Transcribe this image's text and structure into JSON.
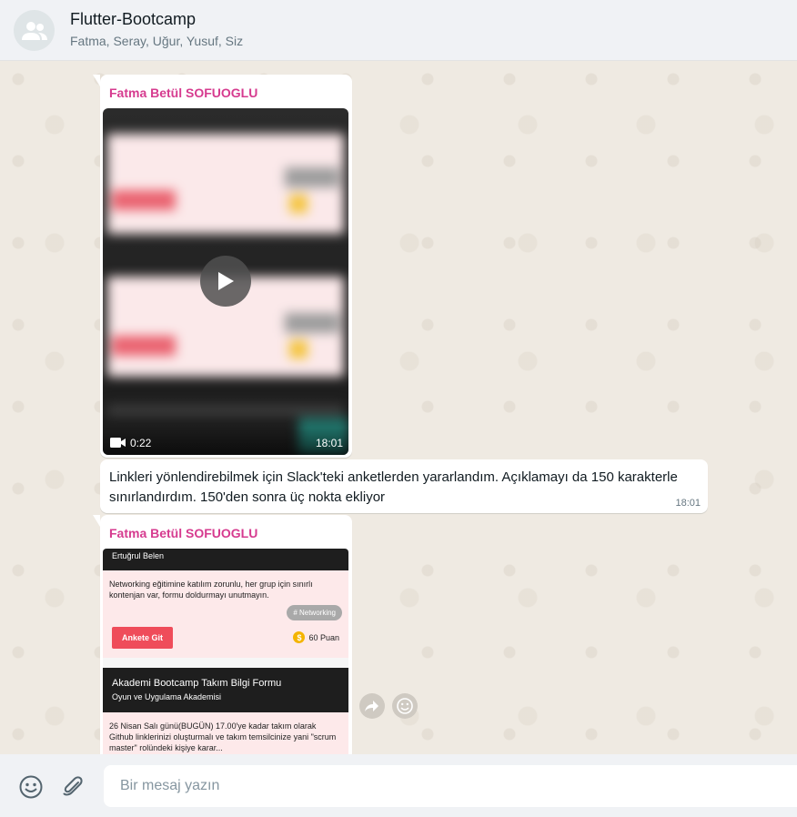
{
  "header": {
    "title": "Flutter-Bootcamp",
    "members": "Fatma, Seray, Uğur, Yusuf, Siz"
  },
  "messages": {
    "video": {
      "sender": "Fatma Betül SOFUOGLU",
      "duration": "0:22",
      "time": "18:01",
      "icons": [
        "play-icon",
        "video-camera-icon"
      ]
    },
    "text": {
      "body": "Linkleri yönlendirebilmek için Slack'teki anketlerden yararlandım. Açıklamayı da 150 karakterle sınırlandırdım. 150'den sonra üç nokta ekliyor",
      "time": "18:01"
    },
    "image": {
      "sender": "Fatma Betül SOFUOGLU",
      "card1": {
        "author": "Ertuğrul Belen",
        "description": "Networking eğitimine katılım zorunlu, her grup için sınırlı kontenjan var, formu doldurmayı unutmayın.",
        "tag": "# Networking",
        "button": "Ankete Git",
        "coin_symbol": "$",
        "points": "60 Puan"
      },
      "card2": {
        "title": "Akademi Bootcamp Takım Bilgi Formu",
        "subtitle": "Oyun ve Uygulama Akademisi",
        "description": "26 Nisan Salı günü(BUGÜN) 17.00'ye kadar takım olarak Github linklerinizi oluşturmalı ve takım temsilcinize yani \"scrum master\" rolündeki kişiye karar..."
      }
    }
  },
  "footer": {
    "placeholder": "Bir mesaj yazın",
    "icons": [
      "emoji-icon",
      "attach-icon"
    ]
  },
  "colors": {
    "sender": "#d63b8f",
    "header_bg": "#f0f2f5",
    "chat_bg": "#efeae2",
    "cta": "#ef4c5a"
  }
}
